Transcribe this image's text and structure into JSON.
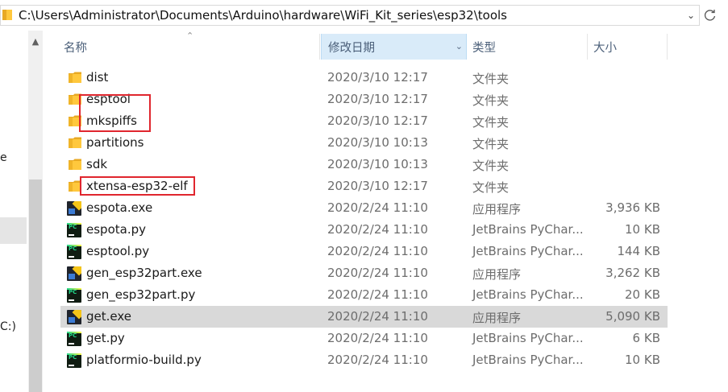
{
  "address_bar": {
    "path": "C:\\Users\\Administrator\\Documents\\Arduino\\hardware\\WiFi_Kit_series\\esp32\\tools"
  },
  "nav_fragments": {
    "frag1": "e",
    "frag2": "C:)"
  },
  "columns": {
    "name": "名称",
    "date": "修改日期",
    "type": "类型",
    "size": "大小"
  },
  "files": [
    {
      "name": "dist",
      "date": "2020/3/10 12:17",
      "type": "文件夹",
      "size": "",
      "icon": "folder-icon"
    },
    {
      "name": "esptool",
      "date": "2020/3/10 12:17",
      "type": "文件夹",
      "size": "",
      "icon": "folder-icon"
    },
    {
      "name": "mkspiffs",
      "date": "2020/3/10 12:17",
      "type": "文件夹",
      "size": "",
      "icon": "folder-icon"
    },
    {
      "name": "partitions",
      "date": "2020/3/10 10:13",
      "type": "文件夹",
      "size": "",
      "icon": "folder-icon"
    },
    {
      "name": "sdk",
      "date": "2020/3/10 10:13",
      "type": "文件夹",
      "size": "",
      "icon": "folder-icon"
    },
    {
      "name": "xtensa-esp32-elf",
      "date": "2020/3/10 12:17",
      "type": "文件夹",
      "size": "",
      "icon": "folder-icon"
    },
    {
      "name": "espota.exe",
      "date": "2020/2/24 11:10",
      "type": "应用程序",
      "size": "3,936 KB",
      "icon": "exe-icon"
    },
    {
      "name": "espota.py",
      "date": "2020/2/24 11:10",
      "type": "JetBrains PyChar...",
      "size": "10 KB",
      "icon": "pycharm-icon"
    },
    {
      "name": "esptool.py",
      "date": "2020/2/24 11:10",
      "type": "JetBrains PyChar...",
      "size": "144 KB",
      "icon": "pycharm-icon"
    },
    {
      "name": "gen_esp32part.exe",
      "date": "2020/2/24 11:10",
      "type": "应用程序",
      "size": "3,262 KB",
      "icon": "exe-icon"
    },
    {
      "name": "gen_esp32part.py",
      "date": "2020/2/24 11:10",
      "type": "JetBrains PyChar...",
      "size": "20 KB",
      "icon": "pycharm-icon"
    },
    {
      "name": "get.exe",
      "date": "2020/2/24 11:10",
      "type": "应用程序",
      "size": "5,090 KB",
      "icon": "exe-icon",
      "selected": true
    },
    {
      "name": "get.py",
      "date": "2020/2/24 11:10",
      "type": "JetBrains PyChar...",
      "size": "6 KB",
      "icon": "pycharm-icon"
    },
    {
      "name": "platformio-build.py",
      "date": "2020/2/24 11:10",
      "type": "JetBrains PyChar...",
      "size": "10 KB",
      "icon": "pycharm-icon"
    }
  ],
  "colors": {
    "highlight_box": "#e0262e",
    "folder": "#ffc83d",
    "sorted_header_bg": "#d9ebf9",
    "selected_row_bg": "#d9d9d9"
  }
}
